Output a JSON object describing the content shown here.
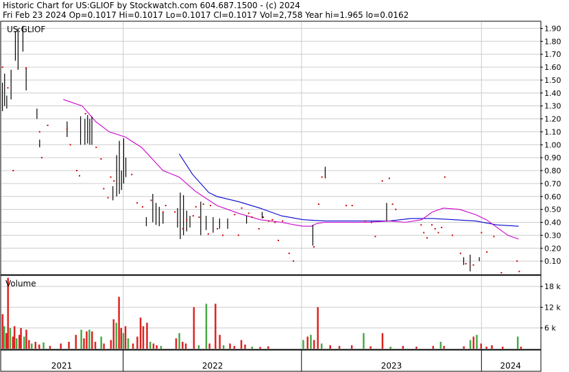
{
  "header": {
    "line1": "Historic Chart for US:GLIOF by Stockwatch.com 604.687.1500 - (c) 2024",
    "line2": "Fri Feb 23 2024   Op=0.1017   Hi=0.1017   Lo=0.1017   Cl=0.1017   Vol=2,758   Year hi=1.965   lo=0.0162"
  },
  "chart_data": [
    {
      "type": "line",
      "title": "US:GLIOF",
      "ylim": [
        0.0,
        1.95
      ],
      "y_ticks": [
        "1.90",
        "1.80",
        "1.70",
        "1.60",
        "1.50",
        "1.40",
        "1.30",
        "1.20",
        "1.10",
        "1.00",
        "0.90",
        "0.80",
        "0.70",
        "0.60",
        "0.50",
        "0.40",
        "0.30",
        "0.20",
        "0.10"
      ],
      "x_tick_labels": [
        "2021",
        "2022",
        "2023",
        "2024"
      ],
      "colors": {
        "bars": "#000000",
        "points": "#cc0000",
        "ma_short": "#cc00cc",
        "ma_long": "#0000cc",
        "grid": "#cccccc"
      },
      "price_bars": [
        {
          "x": 0.002,
          "lo": 1.26,
          "hi": 1.48
        },
        {
          "x": 0.006,
          "lo": 1.3,
          "hi": 1.55
        },
        {
          "x": 0.01,
          "lo": 1.28,
          "hi": 1.38
        },
        {
          "x": 0.018,
          "lo": 1.35,
          "hi": 1.58
        },
        {
          "x": 0.026,
          "lo": 1.65,
          "hi": 1.88
        },
        {
          "x": 0.031,
          "lo": 1.58,
          "hi": 1.9
        },
        {
          "x": 0.04,
          "lo": 1.72,
          "hi": 1.92
        },
        {
          "x": 0.046,
          "lo": 1.42,
          "hi": 1.6
        },
        {
          "x": 0.066,
          "lo": 1.2,
          "hi": 1.28
        },
        {
          "x": 0.071,
          "lo": 0.98,
          "hi": 1.04
        },
        {
          "x": 0.122,
          "lo": 1.06,
          "hi": 1.18
        },
        {
          "x": 0.147,
          "lo": 1.0,
          "hi": 1.22
        },
        {
          "x": 0.155,
          "lo": 1.0,
          "hi": 1.2
        },
        {
          "x": 0.16,
          "lo": 1.01,
          "hi": 1.23
        },
        {
          "x": 0.164,
          "lo": 1.0,
          "hi": 1.2
        },
        {
          "x": 0.168,
          "lo": 1.0,
          "hi": 1.22
        },
        {
          "x": 0.207,
          "lo": 0.57,
          "hi": 0.68
        },
        {
          "x": 0.214,
          "lo": 0.6,
          "hi": 0.92
        },
        {
          "x": 0.219,
          "lo": 0.62,
          "hi": 1.03
        },
        {
          "x": 0.223,
          "lo": 0.65,
          "hi": 0.8
        },
        {
          "x": 0.227,
          "lo": 0.7,
          "hi": 1.05
        },
        {
          "x": 0.231,
          "lo": 0.75,
          "hi": 0.9
        },
        {
          "x": 0.269,
          "lo": 0.37,
          "hi": 0.44
        },
        {
          "x": 0.281,
          "lo": 0.4,
          "hi": 0.62
        },
        {
          "x": 0.287,
          "lo": 0.38,
          "hi": 0.55
        },
        {
          "x": 0.293,
          "lo": 0.37,
          "hi": 0.52
        },
        {
          "x": 0.3,
          "lo": 0.39,
          "hi": 0.48
        },
        {
          "x": 0.327,
          "lo": 0.36,
          "hi": 0.51
        },
        {
          "x": 0.332,
          "lo": 0.27,
          "hi": 0.63
        },
        {
          "x": 0.338,
          "lo": 0.3,
          "hi": 0.61
        },
        {
          "x": 0.344,
          "lo": 0.33,
          "hi": 0.49
        },
        {
          "x": 0.35,
          "lo": 0.36,
          "hi": 0.45
        },
        {
          "x": 0.37,
          "lo": 0.3,
          "hi": 0.56
        },
        {
          "x": 0.38,
          "lo": 0.34,
          "hi": 0.45
        },
        {
          "x": 0.393,
          "lo": 0.32,
          "hi": 0.44
        },
        {
          "x": 0.405,
          "lo": 0.35,
          "hi": 0.43
        },
        {
          "x": 0.42,
          "lo": 0.35,
          "hi": 0.43
        },
        {
          "x": 0.455,
          "lo": 0.39,
          "hi": 0.45
        },
        {
          "x": 0.484,
          "lo": 0.43,
          "hi": 0.48
        },
        {
          "x": 0.578,
          "lo": 0.22,
          "hi": 0.38
        },
        {
          "x": 0.601,
          "lo": 0.74,
          "hi": 0.83
        },
        {
          "x": 0.715,
          "lo": 0.41,
          "hi": 0.55
        },
        {
          "x": 0.858,
          "lo": 0.07,
          "hi": 0.13
        },
        {
          "x": 0.87,
          "lo": 0.02,
          "hi": 0.15
        },
        {
          "x": 0.887,
          "lo": 0.1,
          "hi": 0.13
        }
      ],
      "price_points": [
        {
          "x": 0.002,
          "y": 1.6
        },
        {
          "x": 0.012,
          "y": 1.44
        },
        {
          "x": 0.022,
          "y": 0.8
        },
        {
          "x": 0.046,
          "y": 1.59
        },
        {
          "x": 0.071,
          "y": 1.1
        },
        {
          "x": 0.075,
          "y": 0.9
        },
        {
          "x": 0.086,
          "y": 1.15
        },
        {
          "x": 0.122,
          "y": 1.12
        },
        {
          "x": 0.128,
          "y": 1.0
        },
        {
          "x": 0.14,
          "y": 0.8
        },
        {
          "x": 0.145,
          "y": 0.76
        },
        {
          "x": 0.156,
          "y": 1.24
        },
        {
          "x": 0.176,
          "y": 0.98
        },
        {
          "x": 0.185,
          "y": 0.89
        },
        {
          "x": 0.19,
          "y": 0.66
        },
        {
          "x": 0.198,
          "y": 0.59
        },
        {
          "x": 0.203,
          "y": 0.75
        },
        {
          "x": 0.209,
          "y": 0.72
        },
        {
          "x": 0.242,
          "y": 0.77
        },
        {
          "x": 0.252,
          "y": 0.55
        },
        {
          "x": 0.262,
          "y": 0.52
        },
        {
          "x": 0.278,
          "y": 0.57
        },
        {
          "x": 0.3,
          "y": 0.48
        },
        {
          "x": 0.305,
          "y": 0.53
        },
        {
          "x": 0.322,
          "y": 0.48
        },
        {
          "x": 0.337,
          "y": 0.35
        },
        {
          "x": 0.344,
          "y": 0.42
        },
        {
          "x": 0.356,
          "y": 0.45
        },
        {
          "x": 0.361,
          "y": 0.52
        },
        {
          "x": 0.367,
          "y": 0.44
        },
        {
          "x": 0.375,
          "y": 0.54
        },
        {
          "x": 0.384,
          "y": 0.31
        },
        {
          "x": 0.388,
          "y": 0.53
        },
        {
          "x": 0.401,
          "y": 0.35
        },
        {
          "x": 0.411,
          "y": 0.3
        },
        {
          "x": 0.433,
          "y": 0.46
        },
        {
          "x": 0.44,
          "y": 0.3
        },
        {
          "x": 0.446,
          "y": 0.51
        },
        {
          "x": 0.459,
          "y": 0.47
        },
        {
          "x": 0.465,
          "y": 0.44
        },
        {
          "x": 0.478,
          "y": 0.35
        },
        {
          "x": 0.486,
          "y": 0.44
        },
        {
          "x": 0.496,
          "y": 0.41
        },
        {
          "x": 0.503,
          "y": 0.42
        },
        {
          "x": 0.508,
          "y": 0.4
        },
        {
          "x": 0.514,
          "y": 0.26
        },
        {
          "x": 0.522,
          "y": 0.41
        },
        {
          "x": 0.534,
          "y": 0.16
        },
        {
          "x": 0.542,
          "y": 0.1
        },
        {
          "x": 0.58,
          "y": 0.21
        },
        {
          "x": 0.589,
          "y": 0.54
        },
        {
          "x": 0.595,
          "y": 0.75
        },
        {
          "x": 0.64,
          "y": 0.53
        },
        {
          "x": 0.651,
          "y": 0.53
        },
        {
          "x": 0.675,
          "y": 0.41
        },
        {
          "x": 0.687,
          "y": 0.4
        },
        {
          "x": 0.694,
          "y": 0.29
        },
        {
          "x": 0.707,
          "y": 0.72
        },
        {
          "x": 0.72,
          "y": 0.74
        },
        {
          "x": 0.726,
          "y": 0.54
        },
        {
          "x": 0.732,
          "y": 0.5
        },
        {
          "x": 0.779,
          "y": 0.38
        },
        {
          "x": 0.784,
          "y": 0.32
        },
        {
          "x": 0.79,
          "y": 0.28
        },
        {
          "x": 0.799,
          "y": 0.38
        },
        {
          "x": 0.805,
          "y": 0.35
        },
        {
          "x": 0.811,
          "y": 0.32
        },
        {
          "x": 0.817,
          "y": 0.36
        },
        {
          "x": 0.823,
          "y": 0.75
        },
        {
          "x": 0.837,
          "y": 0.3
        },
        {
          "x": 0.852,
          "y": 0.16
        },
        {
          "x": 0.862,
          "y": 0.08
        },
        {
          "x": 0.876,
          "y": 0.07
        },
        {
          "x": 0.891,
          "y": 0.32
        },
        {
          "x": 0.901,
          "y": 0.17
        },
        {
          "x": 0.914,
          "y": 0.29
        },
        {
          "x": 0.928,
          "y": 0.01
        },
        {
          "x": 0.957,
          "y": 0.1
        },
        {
          "x": 0.961,
          "y": 0.02
        }
      ],
      "ma_short": {
        "x": [
          0.115,
          0.15,
          0.175,
          0.2,
          0.23,
          0.26,
          0.28,
          0.3,
          0.33,
          0.36,
          0.4,
          0.44,
          0.48,
          0.52,
          0.545,
          0.56,
          0.575,
          0.585,
          0.6,
          0.64,
          0.68,
          0.72,
          0.75,
          0.78,
          0.8,
          0.82,
          0.85,
          0.88,
          0.9,
          0.92,
          0.94,
          0.96
        ],
        "y": [
          1.35,
          1.3,
          1.18,
          1.1,
          1.06,
          0.98,
          0.89,
          0.8,
          0.75,
          0.64,
          0.53,
          0.47,
          0.42,
          0.4,
          0.38,
          0.37,
          0.37,
          0.39,
          0.4,
          0.4,
          0.4,
          0.41,
          0.4,
          0.42,
          0.48,
          0.51,
          0.5,
          0.46,
          0.42,
          0.36,
          0.3,
          0.27
        ]
      },
      "ma_long": {
        "x": [
          0.33,
          0.355,
          0.385,
          0.4,
          0.44,
          0.48,
          0.52,
          0.56,
          0.6,
          0.64,
          0.68,
          0.72,
          0.76,
          0.8,
          0.84,
          0.88,
          0.92,
          0.96
        ],
        "y": [
          0.93,
          0.77,
          0.63,
          0.6,
          0.56,
          0.51,
          0.45,
          0.42,
          0.41,
          0.41,
          0.41,
          0.41,
          0.43,
          0.43,
          0.42,
          0.41,
          0.38,
          0.37
        ]
      }
    },
    {
      "type": "bar",
      "title": "Volume",
      "ylim": [
        0,
        21000
      ],
      "y_ticks": [
        "18 k",
        "12 k",
        "6 k"
      ],
      "volume_bars": [
        {
          "x": 0.002,
          "v": 10000,
          "c": "red"
        },
        {
          "x": 0.005,
          "v": 6500,
          "c": "green"
        },
        {
          "x": 0.009,
          "v": 4500,
          "c": "red"
        },
        {
          "x": 0.012,
          "v": 20500,
          "c": "red"
        },
        {
          "x": 0.016,
          "v": 6000,
          "c": "green"
        },
        {
          "x": 0.021,
          "v": 3500,
          "c": "red"
        },
        {
          "x": 0.024,
          "v": 6500,
          "c": "red"
        },
        {
          "x": 0.028,
          "v": 3000,
          "c": "green"
        },
        {
          "x": 0.033,
          "v": 4000,
          "c": "red"
        },
        {
          "x": 0.036,
          "v": 6000,
          "c": "red"
        },
        {
          "x": 0.042,
          "v": 3500,
          "c": "green"
        },
        {
          "x": 0.046,
          "v": 5500,
          "c": "red"
        },
        {
          "x": 0.051,
          "v": 2500,
          "c": "red"
        },
        {
          "x": 0.056,
          "v": 1500,
          "c": "green"
        },
        {
          "x": 0.063,
          "v": 2000,
          "c": "red"
        },
        {
          "x": 0.07,
          "v": 1200,
          "c": "red"
        },
        {
          "x": 0.078,
          "v": 1800,
          "c": "green"
        },
        {
          "x": 0.09,
          "v": 800,
          "c": "red"
        },
        {
          "x": 0.11,
          "v": 1500,
          "c": "red"
        },
        {
          "x": 0.125,
          "v": 2000,
          "c": "red"
        },
        {
          "x": 0.138,
          "v": 4000,
          "c": "red"
        },
        {
          "x": 0.148,
          "v": 5500,
          "c": "green"
        },
        {
          "x": 0.153,
          "v": 3000,
          "c": "red"
        },
        {
          "x": 0.158,
          "v": 5000,
          "c": "red"
        },
        {
          "x": 0.163,
          "v": 5500,
          "c": "green"
        },
        {
          "x": 0.168,
          "v": 5000,
          "c": "red"
        },
        {
          "x": 0.174,
          "v": 2000,
          "c": "red"
        },
        {
          "x": 0.185,
          "v": 3500,
          "c": "green"
        },
        {
          "x": 0.19,
          "v": 1500,
          "c": "red"
        },
        {
          "x": 0.203,
          "v": 2500,
          "c": "red"
        },
        {
          "x": 0.208,
          "v": 8500,
          "c": "red"
        },
        {
          "x": 0.213,
          "v": 7500,
          "c": "green"
        },
        {
          "x": 0.218,
          "v": 15000,
          "c": "red"
        },
        {
          "x": 0.222,
          "v": 6000,
          "c": "red"
        },
        {
          "x": 0.226,
          "v": 4500,
          "c": "green"
        },
        {
          "x": 0.23,
          "v": 6500,
          "c": "red"
        },
        {
          "x": 0.235,
          "v": 3000,
          "c": "green"
        },
        {
          "x": 0.244,
          "v": 1500,
          "c": "red"
        },
        {
          "x": 0.252,
          "v": 3500,
          "c": "red"
        },
        {
          "x": 0.258,
          "v": 9000,
          "c": "red"
        },
        {
          "x": 0.263,
          "v": 6500,
          "c": "red"
        },
        {
          "x": 0.27,
          "v": 7500,
          "c": "red"
        },
        {
          "x": 0.276,
          "v": 2000,
          "c": "green"
        },
        {
          "x": 0.282,
          "v": 1500,
          "c": "red"
        },
        {
          "x": 0.288,
          "v": 1000,
          "c": "red"
        },
        {
          "x": 0.296,
          "v": 800,
          "c": "green"
        },
        {
          "x": 0.324,
          "v": 3000,
          "c": "red"
        },
        {
          "x": 0.33,
          "v": 4500,
          "c": "green"
        },
        {
          "x": 0.336,
          "v": 2000,
          "c": "red"
        },
        {
          "x": 0.342,
          "v": 1500,
          "c": "red"
        },
        {
          "x": 0.357,
          "v": 12000,
          "c": "red"
        },
        {
          "x": 0.366,
          "v": 1000,
          "c": "green"
        },
        {
          "x": 0.38,
          "v": 13000,
          "c": "green"
        },
        {
          "x": 0.386,
          "v": 1500,
          "c": "red"
        },
        {
          "x": 0.397,
          "v": 13000,
          "c": "red"
        },
        {
          "x": 0.405,
          "v": 4000,
          "c": "red"
        },
        {
          "x": 0.412,
          "v": 1000,
          "c": "green"
        },
        {
          "x": 0.424,
          "v": 1500,
          "c": "red"
        },
        {
          "x": 0.432,
          "v": 800,
          "c": "red"
        },
        {
          "x": 0.445,
          "v": 2500,
          "c": "red"
        },
        {
          "x": 0.452,
          "v": 1200,
          "c": "red"
        },
        {
          "x": 0.465,
          "v": 600,
          "c": "green"
        },
        {
          "x": 0.48,
          "v": 500,
          "c": "red"
        },
        {
          "x": 0.495,
          "v": 700,
          "c": "red"
        },
        {
          "x": 0.56,
          "v": 2500,
          "c": "green"
        },
        {
          "x": 0.568,
          "v": 3500,
          "c": "red"
        },
        {
          "x": 0.574,
          "v": 4000,
          "c": "green"
        },
        {
          "x": 0.58,
          "v": 2500,
          "c": "red"
        },
        {
          "x": 0.587,
          "v": 12000,
          "c": "red"
        },
        {
          "x": 0.594,
          "v": 1500,
          "c": "green"
        },
        {
          "x": 0.61,
          "v": 1000,
          "c": "red"
        },
        {
          "x": 0.627,
          "v": 800,
          "c": "red"
        },
        {
          "x": 0.65,
          "v": 1000,
          "c": "red"
        },
        {
          "x": 0.672,
          "v": 4500,
          "c": "green"
        },
        {
          "x": 0.685,
          "v": 700,
          "c": "red"
        },
        {
          "x": 0.707,
          "v": 4500,
          "c": "red"
        },
        {
          "x": 0.722,
          "v": 600,
          "c": "green"
        },
        {
          "x": 0.745,
          "v": 800,
          "c": "red"
        },
        {
          "x": 0.77,
          "v": 600,
          "c": "red"
        },
        {
          "x": 0.801,
          "v": 800,
          "c": "red"
        },
        {
          "x": 0.815,
          "v": 2000,
          "c": "green"
        },
        {
          "x": 0.821,
          "v": 800,
          "c": "red"
        },
        {
          "x": 0.858,
          "v": 700,
          "c": "red"
        },
        {
          "x": 0.87,
          "v": 2500,
          "c": "green"
        },
        {
          "x": 0.876,
          "v": 3500,
          "c": "red"
        },
        {
          "x": 0.882,
          "v": 4000,
          "c": "green"
        },
        {
          "x": 0.89,
          "v": 1500,
          "c": "red"
        },
        {
          "x": 0.9,
          "v": 600,
          "c": "red"
        },
        {
          "x": 0.91,
          "v": 1000,
          "c": "red"
        },
        {
          "x": 0.93,
          "v": 600,
          "c": "red"
        },
        {
          "x": 0.958,
          "v": 3500,
          "c": "green"
        },
        {
          "x": 0.964,
          "v": 600,
          "c": "red"
        }
      ]
    }
  ]
}
